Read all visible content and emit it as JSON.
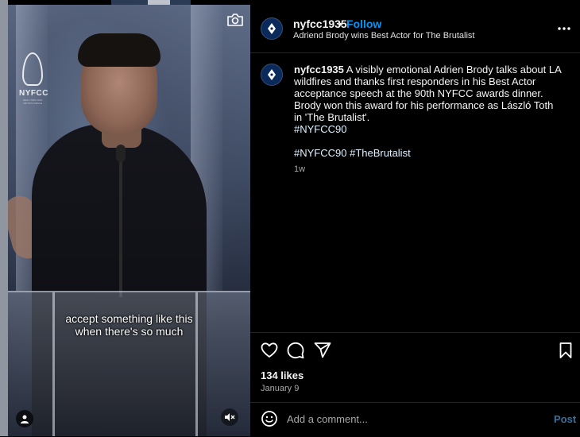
{
  "video": {
    "watermark": {
      "name": "NYFCC",
      "tagline": "NEW YORK FILM CRITICS CIRCLE"
    },
    "subtitles": [
      "accept something like this",
      "when there's so much"
    ],
    "icons": {
      "camera": "camera-icon",
      "user": "user-icon",
      "mute": "speaker-muted-icon"
    }
  },
  "header": {
    "username": "nyfcc1935",
    "separator": "•",
    "follow_label": "Follow",
    "subtitle": "Adriend Brody wins Best Actor for The Brutalist",
    "more_icon": "more-horizontal-icon"
  },
  "caption": {
    "username": "nyfcc1935",
    "text": "A visibly emotional Adrien Brody talks about LA wildfires and thanks first responders in his Best Actor acceptance speech at the 90th NYFCC awards dinner. Brody won this award for his performance as László Toth in 'The Brutalist'.",
    "tag_line_1": "#NYFCC90",
    "tag_line_2a": "#NYFCC90",
    "tag_line_2b": "#TheBrutalist",
    "time": "1w"
  },
  "actions": {
    "icons": [
      "heart-icon",
      "comment-icon",
      "share-icon",
      "bookmark-icon"
    ],
    "likes": "134 likes",
    "date": "January 9"
  },
  "comment": {
    "placeholder": "Add a comment...",
    "post_label": "Post",
    "emoji_icon": "emoji-icon"
  }
}
